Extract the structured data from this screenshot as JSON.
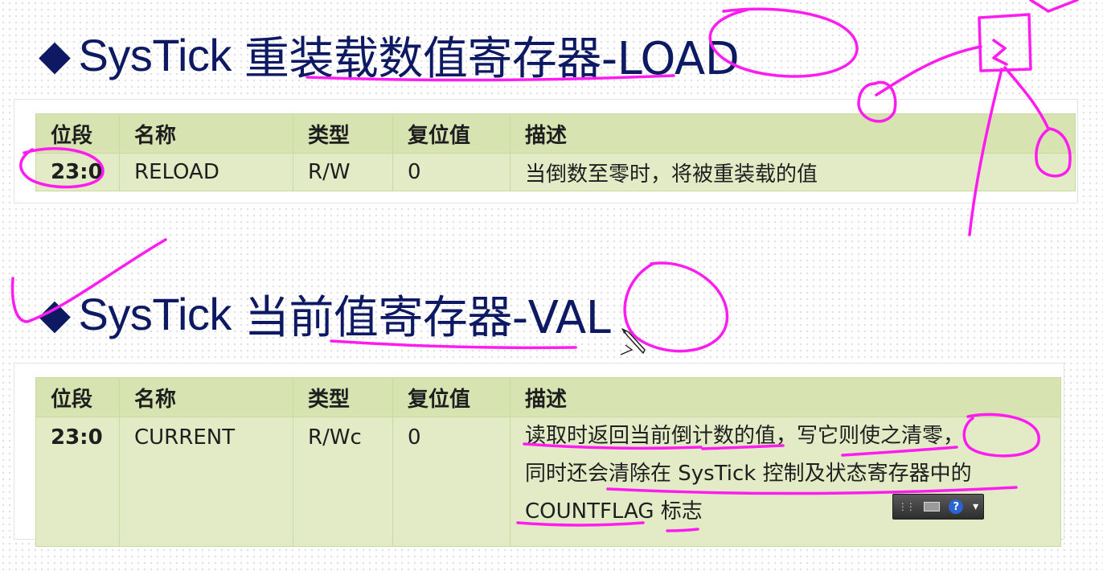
{
  "sections": [
    {
      "heading": {
        "bullet": "◆",
        "latin": "SysTick",
        "cjk": "重装载数值寄存器-LOAD"
      },
      "table": {
        "headers": [
          "位段",
          "名称",
          "类型",
          "复位值",
          "描述"
        ],
        "rows": [
          {
            "bits": "23:0",
            "name": "RELOAD",
            "type": "R/W",
            "reset": "0",
            "desc": [
              "当倒数至零时，将被重装载的值"
            ]
          }
        ]
      }
    },
    {
      "heading": {
        "bullet": "◆",
        "latin": "SysTick",
        "cjk": "当前值寄存器-VAL"
      },
      "table": {
        "headers": [
          "位段",
          "名称",
          "类型",
          "复位值",
          "描述"
        ],
        "rows": [
          {
            "bits": "23:0",
            "name": "CURRENT",
            "type": "R/Wc",
            "reset": "0",
            "desc": [
              "读取时返回当前倒计数的值，写它则使之清零，",
              "同时还会清除在 SysTick 控制及状态寄存器中的",
              "COUNTFLAG 标志"
            ]
          }
        ]
      }
    }
  ],
  "colors": {
    "heading": "#0d1a63",
    "table_header": "#d8e3b2",
    "table_body": "#e2ebc5",
    "ink": "#ff1cf0"
  },
  "ime_toolbar": {
    "icons": [
      "grip-icon",
      "keyboard-icon",
      "help-icon",
      "options-icon"
    ],
    "help_glyph": "?"
  }
}
